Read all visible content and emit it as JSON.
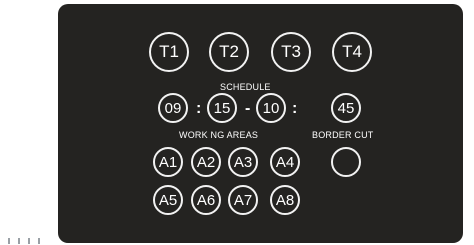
{
  "colors": {
    "panel_background": "#242321",
    "circle_outline": "#f2f2f2",
    "text": "#ffffff",
    "page_background": "#ffffff"
  },
  "tabs": [
    "T1",
    "T2",
    "T3",
    "T4"
  ],
  "schedule": {
    "label": "SCHEDULE",
    "start_hour": "09",
    "start_minute": "15",
    "end_hour": "10",
    "end_minute": "45",
    "time_separator": ":",
    "range_separator": "-"
  },
  "working_areas": {
    "label": "WORK NG AREAS",
    "areas": [
      "A1",
      "A2",
      "A3",
      "A4",
      "A5",
      "A6",
      "A7",
      "A8"
    ]
  },
  "border_cut": {
    "label": "BORDER CUT"
  }
}
